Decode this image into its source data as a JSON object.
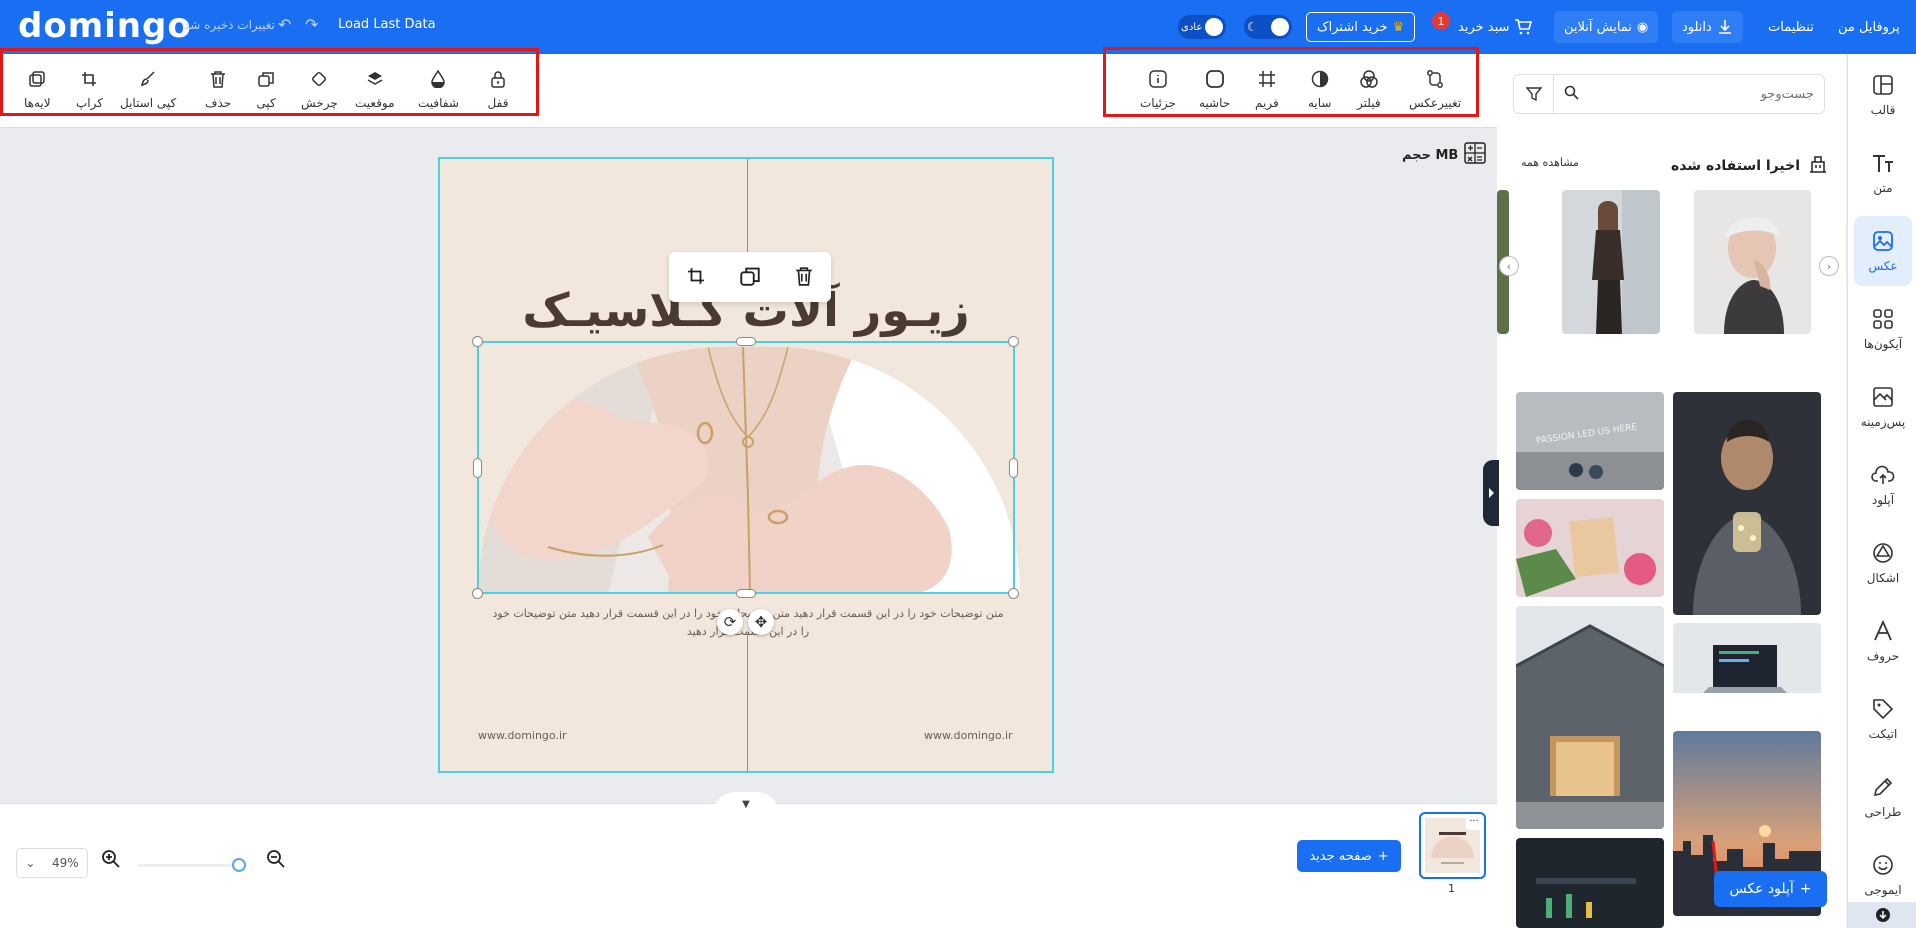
{
  "topbar": {
    "logo": "domingo",
    "saved_text": "تغییرات ذخیره شد",
    "load_last": "Load Last Data",
    "theme_label": "عادی",
    "subscribe": "خرید اشتراک",
    "cart": "سبد خرید",
    "cart_count": "1",
    "preview": "نمایش آنلاین",
    "download": "دانلود",
    "settings": "تنظیمات",
    "profile": "پروفایل من"
  },
  "toolbar": {
    "left_tools": [
      "لایه‌ها",
      "کراپ",
      "کپی استایل",
      "حذف",
      "کپی",
      "چرخش",
      "موقعیت",
      "شفافیت",
      "قفل"
    ],
    "right_tools": [
      "جزئیات",
      "حاشیه",
      "فریم",
      "سایه",
      "فیلتر",
      "تغییرعکس"
    ]
  },
  "canvas": {
    "size_label": "حجم MB",
    "title": "زیـور آلات کـلاسیـک",
    "description": "متن توضیحات خود را در این قسمت قرار دهید متن توضیحات خود را در این قسمت قرار دهید متن توضیحات خود را در این قسمت قرار دهید",
    "website_left": "www.domingo.ir",
    "website_right": "www.domingo.ir"
  },
  "bottom": {
    "zoom": "49%",
    "new_page": "صفحه جدید",
    "page_number": "1"
  },
  "panel": {
    "search_placeholder": "جست‌وجو",
    "recent_title": "اخیرا استفاده شده",
    "see_all": "مشاهده همه",
    "upload_button": "آپلود عکس"
  },
  "sidebar": {
    "items": [
      {
        "label": "قالب",
        "icon": "template-icon"
      },
      {
        "label": "متن",
        "icon": "text-icon"
      },
      {
        "label": "عکس",
        "icon": "image-icon"
      },
      {
        "label": "آیکون‌ها",
        "icon": "grid-icon"
      },
      {
        "label": "پس‌زمینه",
        "icon": "background-icon"
      },
      {
        "label": "آپلود",
        "icon": "cloud-upload-icon"
      },
      {
        "label": "اشکال",
        "icon": "shapes-icon"
      },
      {
        "label": "حروف",
        "icon": "letters-icon"
      },
      {
        "label": "اتیکت",
        "icon": "tag-icon"
      },
      {
        "label": "طراحی",
        "icon": "pen-icon"
      },
      {
        "label": "ایموجی",
        "icon": "emoji-icon"
      }
    ]
  },
  "colors": {
    "brand": "#1a6ef2",
    "highlight": "#e01818",
    "selection": "#4ccfe0",
    "canvas_bg": "#f1e7dd"
  }
}
